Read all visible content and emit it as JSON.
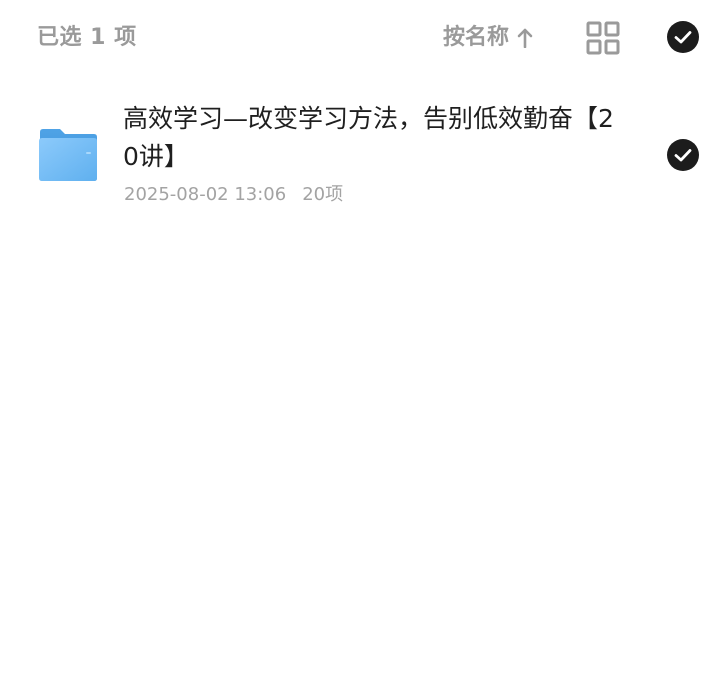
{
  "toolbar": {
    "selected_label": "已选 1 项",
    "sort_label": "按名称",
    "sort_direction_icon": "arrow-up-icon",
    "view_toggle_icon": "grid-view-icon",
    "select_all_icon": "check-circle-icon"
  },
  "files": [
    {
      "name": "高效学习—改变学习方法，告别低效勤奋【20讲】",
      "date": "2025-08-02 13:06",
      "count": "20项",
      "icon": "folder-icon",
      "selected": true
    }
  ],
  "colors": {
    "muted_text": "#9a9a9a",
    "title_text": "#1f1f1f",
    "check_fill": "#1c1c1c",
    "folder_blue": "#6db6f2"
  }
}
